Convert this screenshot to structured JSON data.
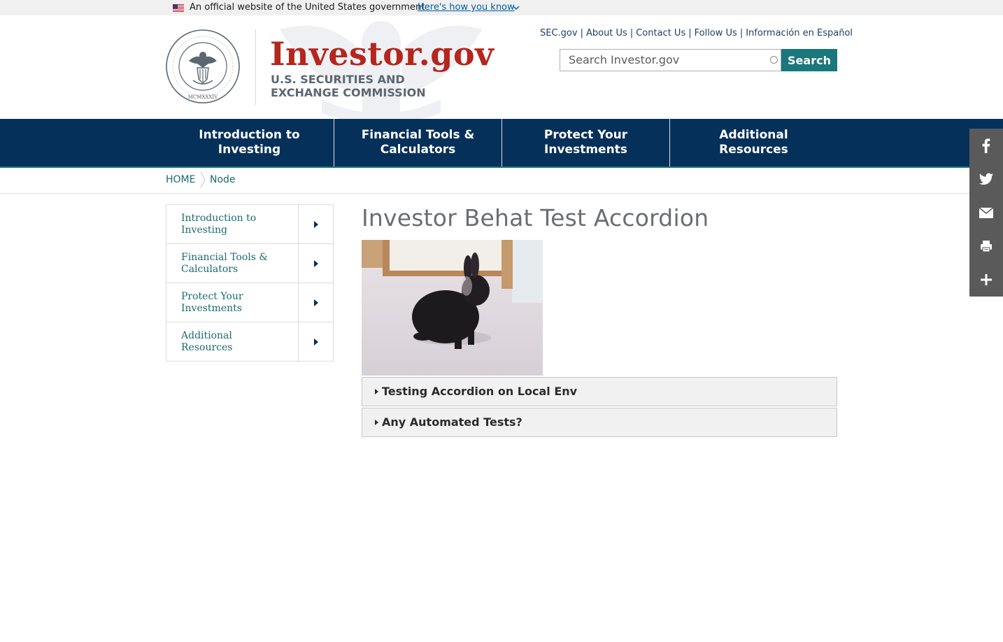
{
  "gov_banner": {
    "official_text": "An official website of the United States government",
    "how_you_know": "Here's how you know"
  },
  "header": {
    "brand": "Investor.gov",
    "agency_line1": "U.S. SECURITIES AND",
    "agency_line2": "EXCHANGE COMMISSION",
    "seal_alt": "U.S. Securities and Exchange Commission seal",
    "utility_links": [
      "SEC.gov",
      "About Us",
      "Contact Us",
      "Follow Us",
      "Información en Español"
    ],
    "search": {
      "placeholder": "Search Investor.gov",
      "button": "Search"
    }
  },
  "main_nav": {
    "items": [
      {
        "line1": "Introduction to",
        "line2": "Investing"
      },
      {
        "line1": "Financial Tools &",
        "line2": "Calculators"
      },
      {
        "line1": "Protect Your",
        "line2": "Investments"
      },
      {
        "line1": "Additional",
        "line2": "Resources"
      }
    ]
  },
  "breadcrumb": {
    "home": "HOME",
    "current": "Node"
  },
  "side_nav": {
    "items": [
      {
        "line1": "Introduction to",
        "line2": "Investing"
      },
      {
        "line1": "Financial Tools &",
        "line2": "Calculators"
      },
      {
        "line1": "Protect Your",
        "line2": "Investments"
      },
      {
        "line1": "Additional",
        "line2": "Resources"
      }
    ]
  },
  "content": {
    "title": "Investor Behat Test Accordion",
    "image_alt": "Black rabbit sitting on a carpet",
    "accordion": [
      {
        "label": "Testing Accordion on Local Env"
      },
      {
        "label": "Any Automated Tests?"
      }
    ]
  },
  "share_rail": {
    "icons": [
      "facebook-icon",
      "twitter-icon",
      "email-icon",
      "print-icon",
      "plus-icon"
    ]
  },
  "colors": {
    "brand_red": "#b5261e",
    "nav_blue": "#05305a",
    "teal": "#1a777b",
    "share_gray": "#5a5a5a"
  }
}
